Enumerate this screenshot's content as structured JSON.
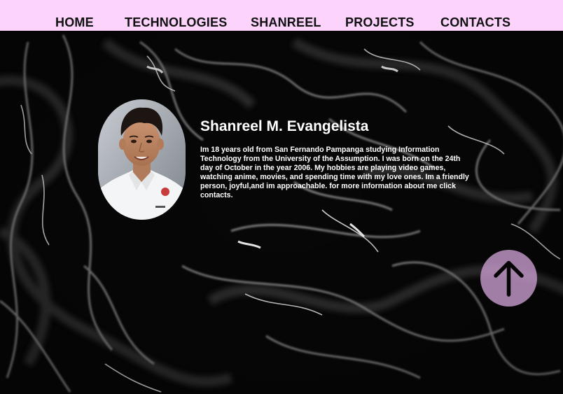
{
  "nav": {
    "items": [
      {
        "label": "HOME"
      },
      {
        "label": "TECHNOLOGIES"
      },
      {
        "label": "SHANREEL"
      },
      {
        "label": "PROJECTS"
      },
      {
        "label": "CONTACTS"
      }
    ]
  },
  "profile": {
    "name": "Shanreel M. Evangelista",
    "bio": "Im 18 years old from San Fernando Pampanga studying Information Technology from the University of the Assumption.  I was born on the 24th day of October in the year 2006. My hobbies are playing video games, watching anime, movies, and spending time with my love ones. Im a friendly person, joyful,and im  approachable. for more information about me click contacts."
  },
  "scroll_top": {
    "icon": "arrow-up-icon"
  },
  "colors": {
    "nav_background": "#fbd3fb",
    "nav_text": "#111111",
    "page_background": "#060606",
    "text": "#ffffff",
    "scroll_button": "#cda0d2"
  }
}
